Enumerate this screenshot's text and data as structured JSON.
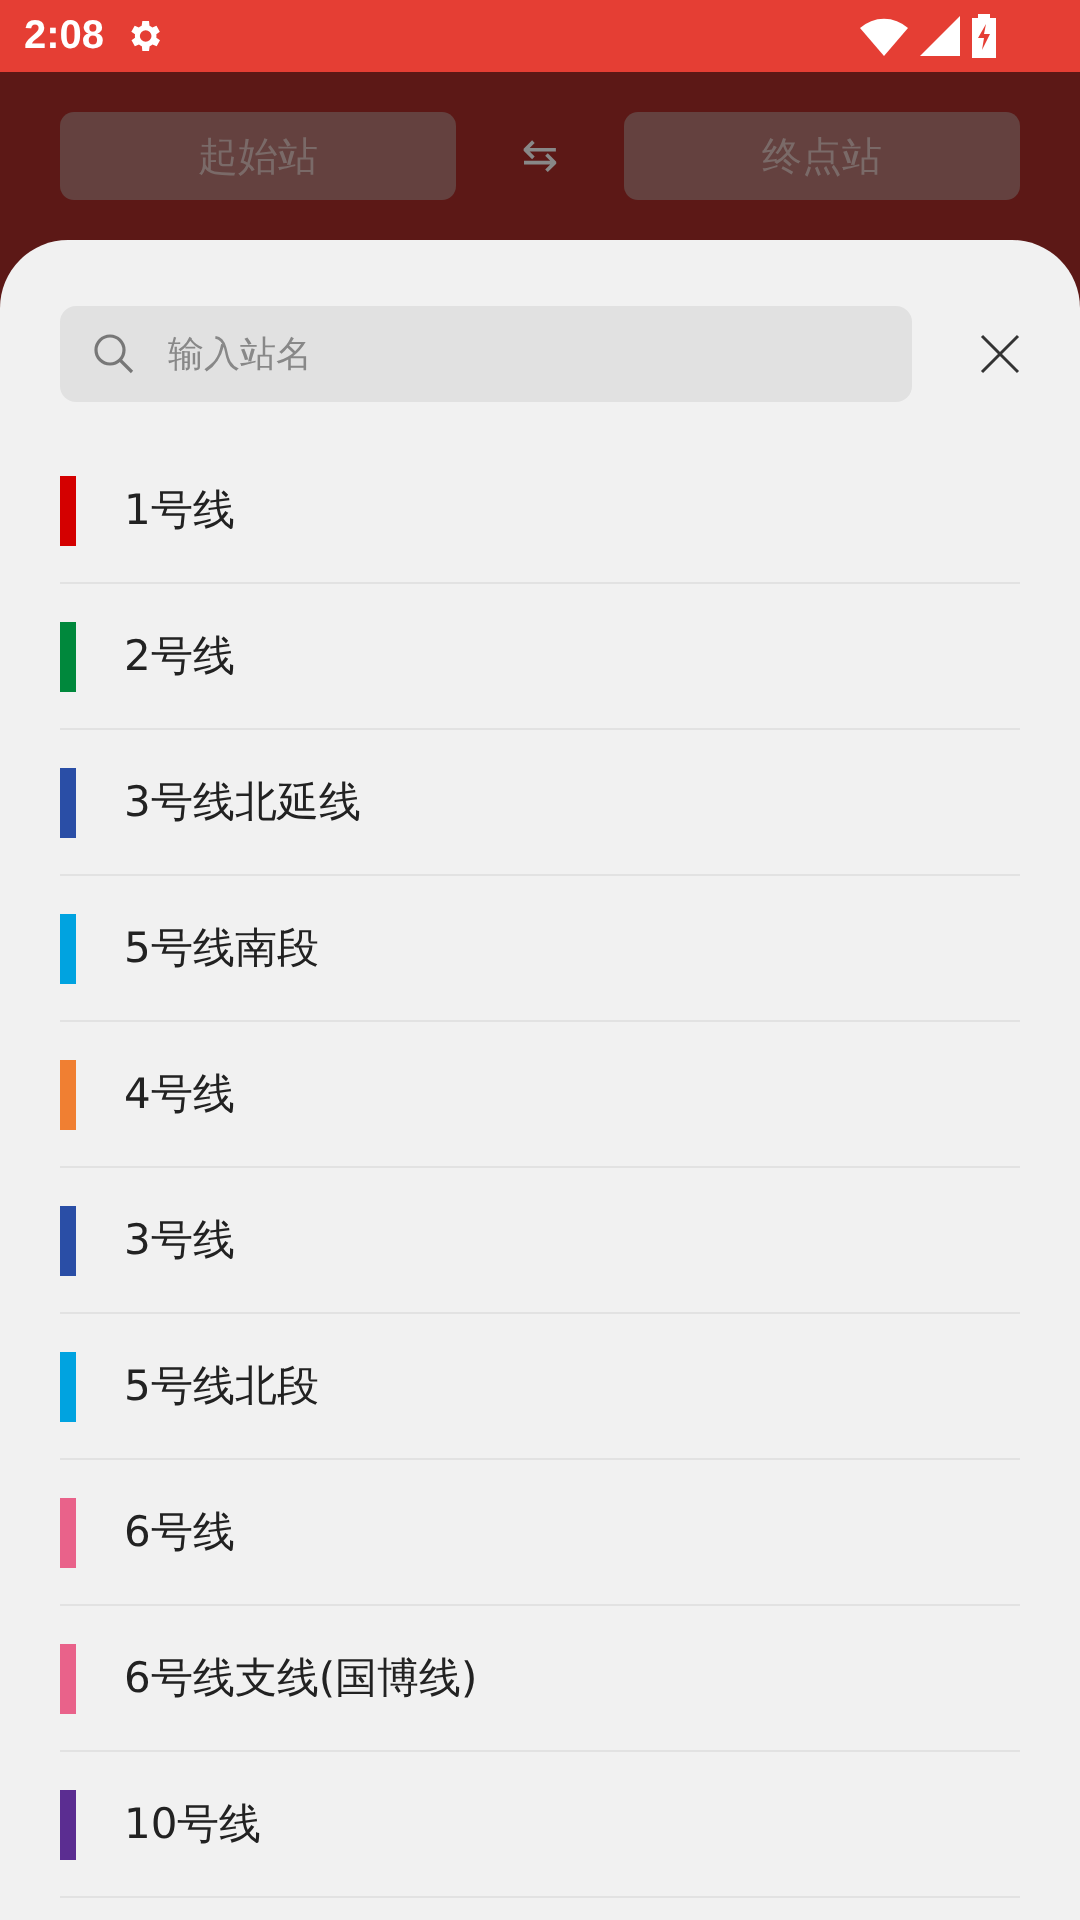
{
  "status_bar": {
    "time": "2:08"
  },
  "header": {
    "from": "起始站",
    "swap": "⇆",
    "to": "终点站"
  },
  "search": {
    "placeholder": "输入站名"
  },
  "lines": [
    {
      "name": "1号线",
      "color": "#d40000"
    },
    {
      "name": "2号线",
      "color": "#00883c"
    },
    {
      "name": "3号线北延线",
      "color": "#2a4ea6"
    },
    {
      "name": "5号线南段",
      "color": "#00a3e0"
    },
    {
      "name": "4号线",
      "color": "#f07f32"
    },
    {
      "name": "3号线",
      "color": "#2a4ea6"
    },
    {
      "name": "5号线北段",
      "color": "#00a3e0"
    },
    {
      "name": "6号线",
      "color": "#e9628a"
    },
    {
      "name": "6号线支线(国博线)",
      "color": "#e9628a"
    },
    {
      "name": "10号线",
      "color": "#5b2d91"
    }
  ]
}
